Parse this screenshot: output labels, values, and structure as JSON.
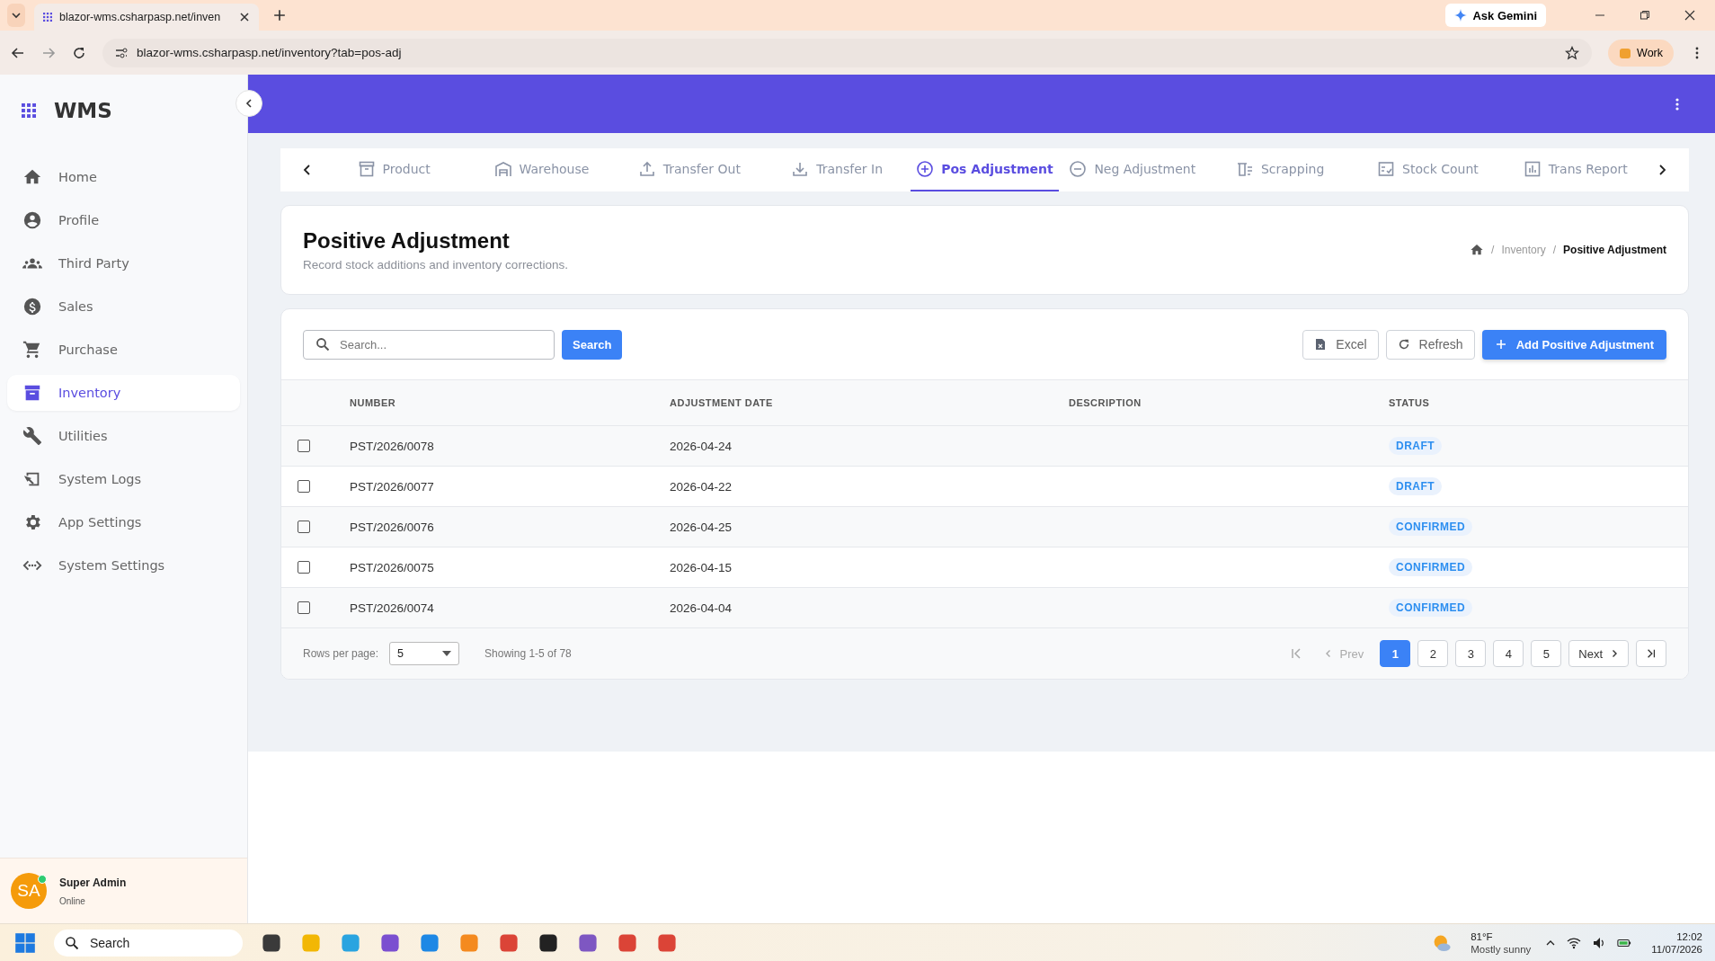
{
  "browser": {
    "tab_title": "blazor-wms.csharpasp.net/inven",
    "url": "blazor-wms.csharpasp.net/inventory?tab=pos-adj",
    "gemini": "Ask Gemini",
    "profile": "Work"
  },
  "sidebar": {
    "brand": "WMS",
    "items": [
      {
        "label": "Home",
        "selected": false
      },
      {
        "label": "Profile",
        "selected": false
      },
      {
        "label": "Third Party",
        "selected": false
      },
      {
        "label": "Sales",
        "selected": false
      },
      {
        "label": "Purchase",
        "selected": false
      },
      {
        "label": "Inventory",
        "selected": true
      },
      {
        "label": "Utilities",
        "selected": false
      },
      {
        "label": "System Logs",
        "selected": false
      },
      {
        "label": "App Settings",
        "selected": false
      },
      {
        "label": "System Settings",
        "selected": false
      }
    ],
    "user": {
      "initials": "SA",
      "name": "Super Admin",
      "status": "Online"
    }
  },
  "tabs": [
    {
      "label": "Product",
      "selected": false
    },
    {
      "label": "Warehouse",
      "selected": false
    },
    {
      "label": "Transfer Out",
      "selected": false
    },
    {
      "label": "Transfer In",
      "selected": false
    },
    {
      "label": "Pos Adjustment",
      "selected": true
    },
    {
      "label": "Neg Adjustment",
      "selected": false
    },
    {
      "label": "Scrapping",
      "selected": false
    },
    {
      "label": "Stock Count",
      "selected": false
    },
    {
      "label": "Trans Report",
      "selected": false
    }
  ],
  "page": {
    "title": "Positive Adjustment",
    "subtitle": "Record stock additions and inventory corrections.",
    "breadcrumb_separator": "/",
    "breadcrumbs": [
      "Inventory",
      "Positive Adjustment"
    ]
  },
  "toolbar": {
    "search": {
      "placeholder": "Search..."
    },
    "search_button": "Search",
    "excel": "Excel",
    "refresh": "Refresh",
    "add": "Add Positive Adjustment"
  },
  "table": {
    "columns": [
      "NUMBER",
      "ADJUSTMENT DATE",
      "DESCRIPTION",
      "STATUS"
    ],
    "rows": [
      {
        "checked": false,
        "number": "PST/2026/0078",
        "date": "2026-04-24",
        "status": "DRAFT"
      },
      {
        "checked": false,
        "number": "PST/2026/0077",
        "date": "2026-04-22",
        "status": "DRAFT"
      },
      {
        "checked": false,
        "number": "PST/2026/0076",
        "date": "2026-04-25",
        "status": "CONFIRMED"
      },
      {
        "checked": false,
        "number": "PST/2026/0075",
        "date": "2026-04-15",
        "status": "CONFIRMED"
      },
      {
        "checked": false,
        "number": "PST/2026/0074",
        "date": "2026-04-04",
        "status": "CONFIRMED"
      }
    ]
  },
  "pagination": {
    "rows_per_page_label": "Rows per page:",
    "rows_per_page": "5",
    "showing": "Showing 1-5 of 78",
    "prev": "Prev",
    "next": "Next",
    "pages": [
      {
        "label": "1",
        "selected": true
      },
      {
        "label": "2",
        "selected": false
      },
      {
        "label": "3",
        "selected": false
      },
      {
        "label": "4",
        "selected": false
      },
      {
        "label": "5",
        "selected": false
      }
    ]
  },
  "taskbar": {
    "search": "Search",
    "temperature": "81°F",
    "weather": "Mostly sunny",
    "time": "12:02",
    "date": "11/07/2026"
  }
}
